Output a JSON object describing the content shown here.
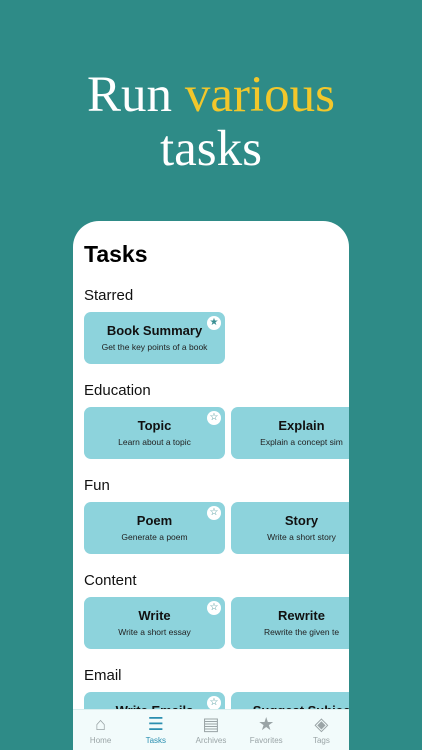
{
  "headline": {
    "part1": "Run ",
    "accent": "various",
    "line2": "tasks"
  },
  "screen": {
    "title": "Tasks",
    "sections": [
      {
        "label": "Starred",
        "cards": [
          {
            "title": "Book Summary",
            "subtitle": "Get the key points of a book",
            "starred": true
          }
        ]
      },
      {
        "label": "Education",
        "cards": [
          {
            "title": "Topic",
            "subtitle": "Learn about a topic",
            "starred": false
          },
          {
            "title": "Explain",
            "subtitle": "Explain a concept sim",
            "starred": false
          }
        ]
      },
      {
        "label": "Fun",
        "cards": [
          {
            "title": "Poem",
            "subtitle": "Generate a poem",
            "starred": false
          },
          {
            "title": "Story",
            "subtitle": "Write a short story",
            "starred": false
          }
        ]
      },
      {
        "label": "Content",
        "cards": [
          {
            "title": "Write",
            "subtitle": "Write a short essay",
            "starred": false
          },
          {
            "title": "Rewrite",
            "subtitle": "Rewrite the given te",
            "starred": false
          }
        ]
      },
      {
        "label": "Email",
        "cards": [
          {
            "title": "Write Emails",
            "subtitle": "",
            "starred": false
          },
          {
            "title": "Suggest Subjec",
            "subtitle": "",
            "starred": false
          }
        ]
      }
    ]
  },
  "star_glyphs": {
    "filled": "★",
    "empty": "☆"
  },
  "tabbar": {
    "items": [
      {
        "label": "Home",
        "icon": "house-icon",
        "glyph": "⌂"
      },
      {
        "label": "Tasks",
        "icon": "list-icon",
        "glyph": "☰"
      },
      {
        "label": "Archives",
        "icon": "archive-box-icon",
        "glyph": "▤"
      },
      {
        "label": "Favorites",
        "icon": "star-icon",
        "glyph": "★"
      },
      {
        "label": "Tags",
        "icon": "tag-icon",
        "glyph": "◈"
      }
    ],
    "active_index": 1
  },
  "colors": {
    "background": "#2e8b87",
    "accent_text": "#f2c72b",
    "card": "#8dd3dc",
    "active_tab": "#2b8fb0"
  }
}
